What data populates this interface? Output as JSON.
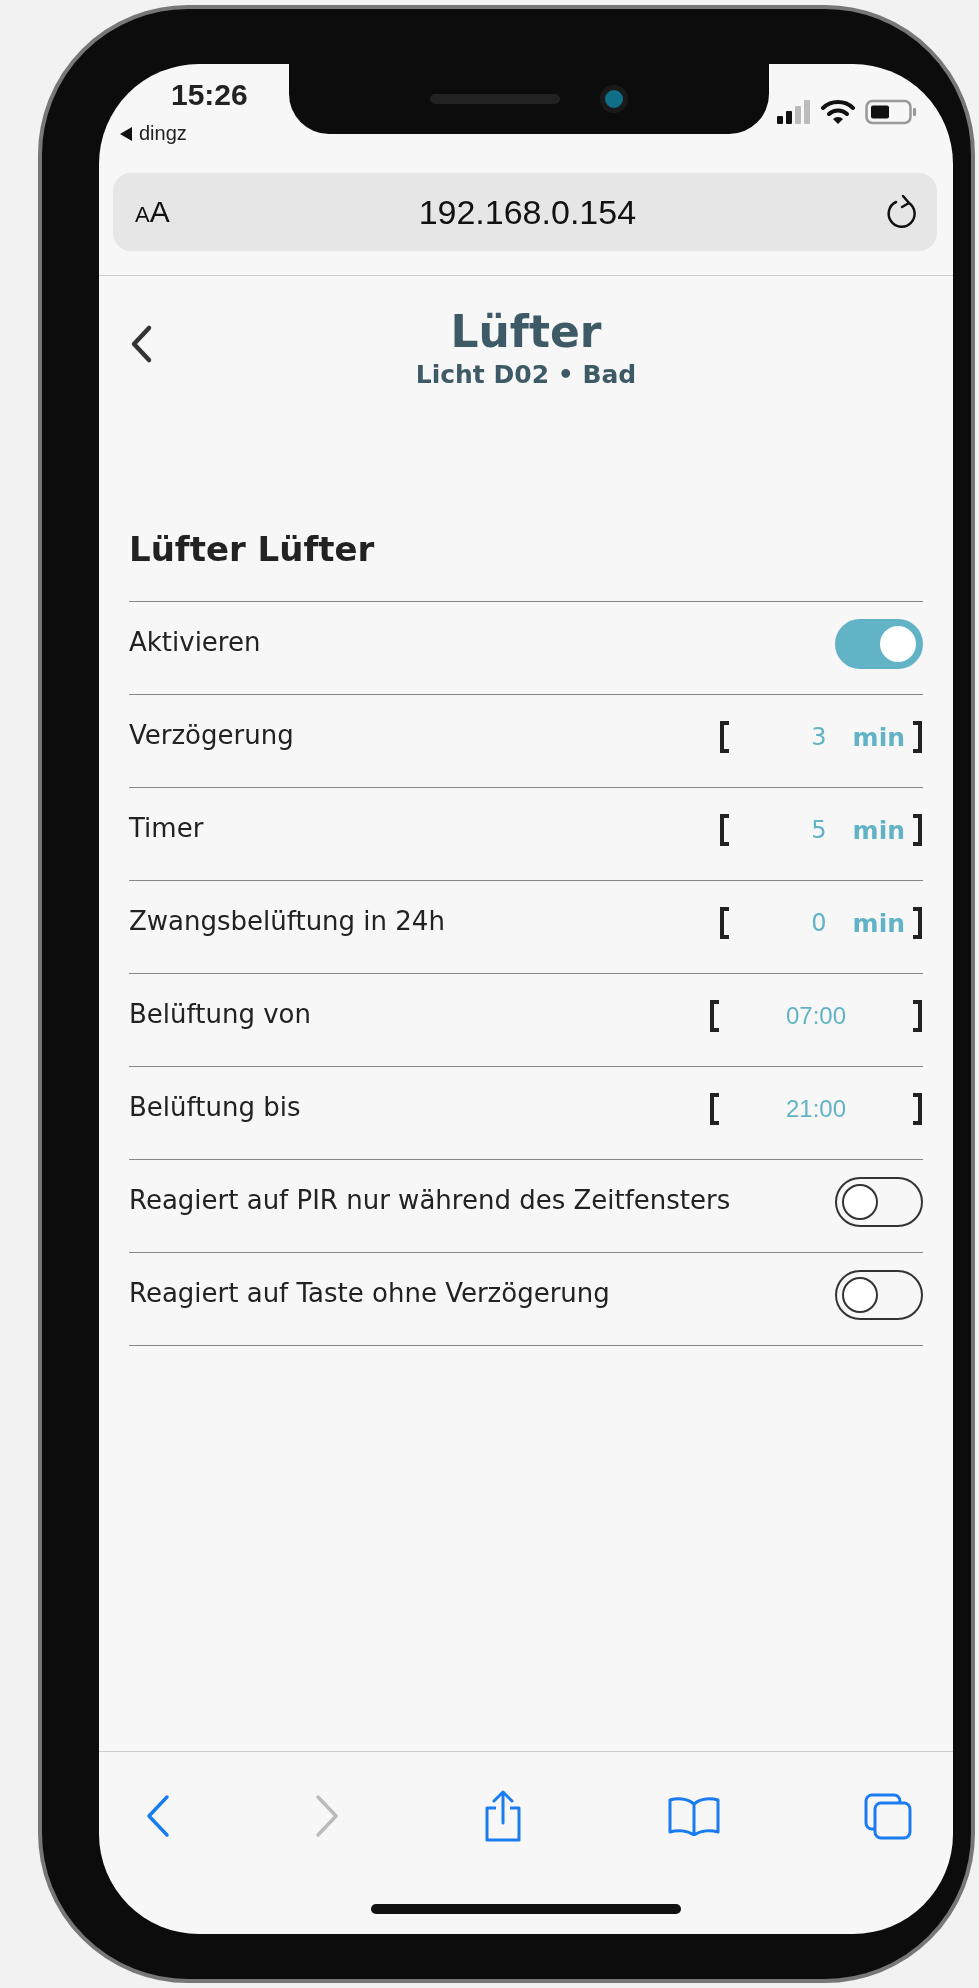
{
  "status_bar": {
    "time": "15:26",
    "back_app": "dingz"
  },
  "address_bar": {
    "reader_label": "AA",
    "url": "192.168.0.154"
  },
  "header": {
    "title": "Lüfter",
    "subtitle": "Licht D02 • Bad"
  },
  "section": {
    "title": "Lüfter Lüfter"
  },
  "settings": [
    {
      "kind": "toggle",
      "label": "Aktivieren",
      "on": true
    },
    {
      "kind": "number",
      "label": "Verzögerung",
      "value": "3",
      "unit": "min"
    },
    {
      "kind": "number",
      "label": "Timer",
      "value": "5",
      "unit": "min"
    },
    {
      "kind": "number",
      "label": "Zwangsbelüftung in 24h",
      "value": "0",
      "unit": "min"
    },
    {
      "kind": "time",
      "label": "Belüftung von",
      "value": "07:00"
    },
    {
      "kind": "time",
      "label": "Belüftung bis",
      "value": "21:00"
    },
    {
      "kind": "toggle",
      "label": "Reagiert auf PIR nur während des Zeitfensters",
      "on": false
    },
    {
      "kind": "toggle",
      "label": "Reagiert auf Taste ohne Verzögerung",
      "on": false
    }
  ],
  "toolbar": {
    "back_disabled": false,
    "forward_disabled": true
  }
}
